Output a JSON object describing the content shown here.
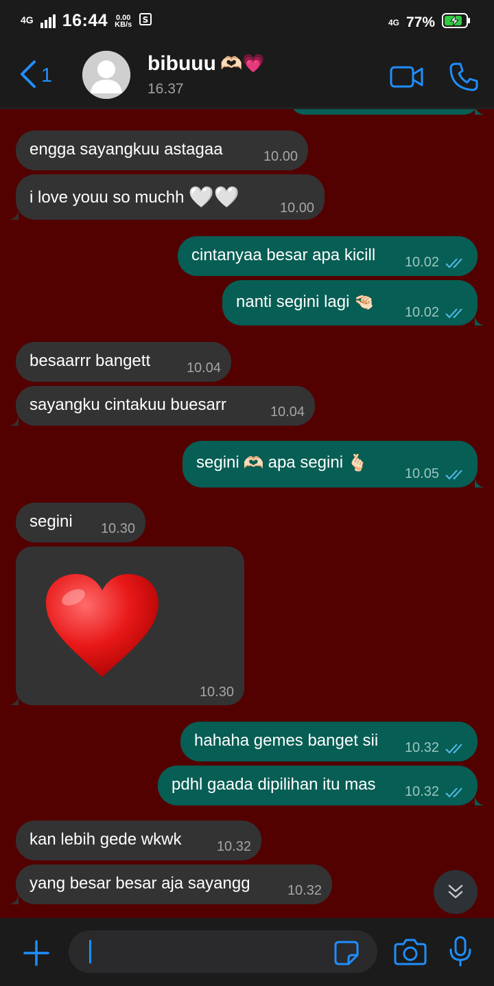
{
  "status_bar": {
    "network": "4G",
    "time": "16:44",
    "speed_value": "0.00",
    "speed_unit": "KB/s",
    "network_right": "4G",
    "battery": "77%"
  },
  "header": {
    "back_count": "1",
    "contact_name": "bibuuu",
    "contact_emoji": "🫶🏻💗",
    "last_seen": "16.37"
  },
  "messages": [
    {
      "dir": "in",
      "text": "engga sayangkuu astagaa",
      "time": "10.00"
    },
    {
      "dir": "in",
      "text": "i love youu so muchh",
      "emoji": "🤍🤍",
      "time": "10.00"
    },
    {
      "dir": "out",
      "text": "cintanyaa besar apa kicill",
      "time": "10.02"
    },
    {
      "dir": "out",
      "text": "nanti segini lagi",
      "emoji": "🤏🏻",
      "time": "10.02"
    },
    {
      "dir": "in",
      "text": "besaarrr bangett",
      "time": "10.04"
    },
    {
      "dir": "in",
      "text": "sayangku cintakuu buesarr",
      "time": "10.04"
    },
    {
      "dir": "out",
      "text": "segini",
      "emoji": "🫶🏻",
      "text2": "apa segini",
      "emoji2": "🫰🏻",
      "time": "10.05"
    },
    {
      "dir": "in",
      "text": "segini",
      "time": "10.30"
    },
    {
      "dir": "in",
      "type": "sticker",
      "sticker": "red-heart",
      "time": "10.30"
    },
    {
      "dir": "out",
      "text": "hahaha gemes banget sii",
      "time": "10.32"
    },
    {
      "dir": "out",
      "text": "pdhl gaada dipilihan itu mas",
      "time": "10.32"
    },
    {
      "dir": "in",
      "text": "kan lebih gede wkwk",
      "time": "10.32"
    },
    {
      "dir": "in",
      "text": "yang besar besar aja sayangg",
      "time": "10.32"
    }
  ],
  "icons": {
    "back": "chevron-left-icon",
    "video": "video-camera-icon",
    "call": "phone-icon",
    "scroll": "double-chevron-down-icon",
    "attach": "plus-icon",
    "sticker": "sticker-icon",
    "camera": "camera-icon",
    "mic": "microphone-icon"
  },
  "colors": {
    "chat_background": "#530000",
    "incoming_bubble": "#333334",
    "outgoing_bubble": "#075e54",
    "accent": "#1f8fff",
    "read_ticks": "#53bdeb"
  }
}
